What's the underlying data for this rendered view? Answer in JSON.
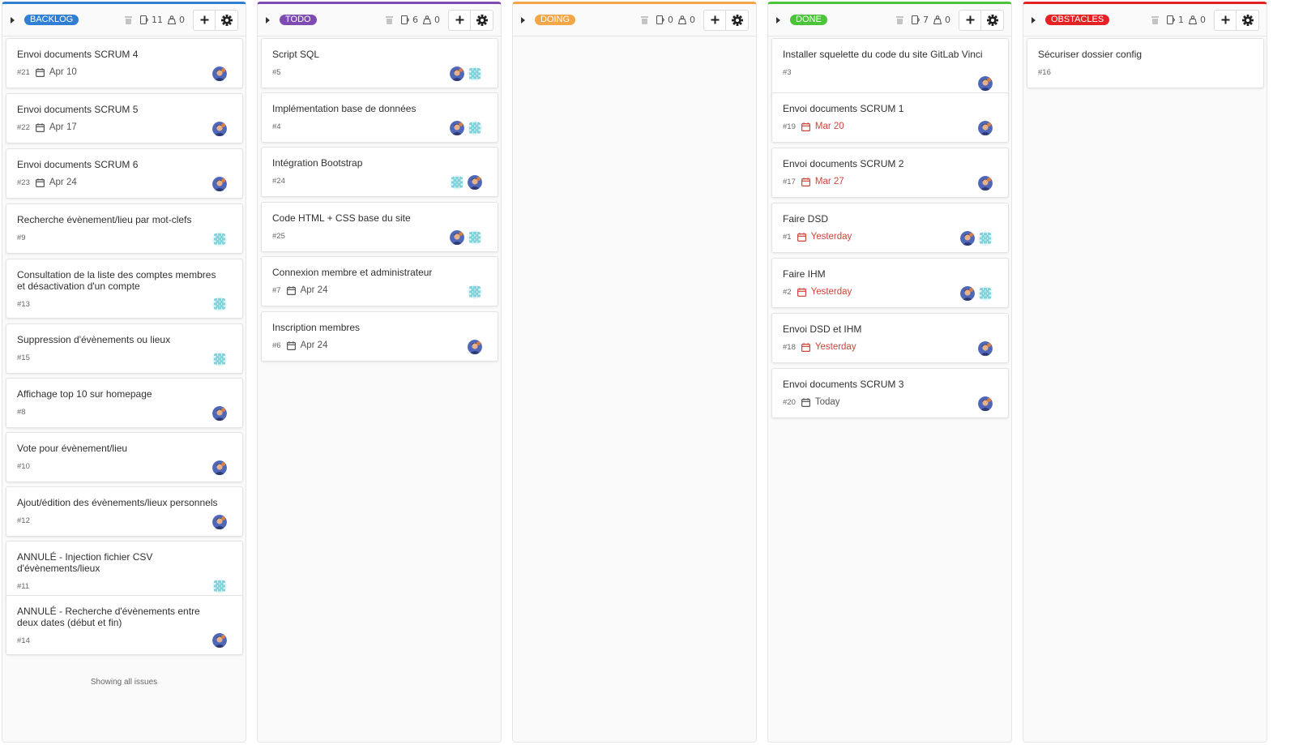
{
  "colors": {
    "backlog": "#2f7fd2",
    "todo": "#7e4bb3",
    "doing": "#f3a646",
    "done": "#4bc43a",
    "obstacles": "#e52124",
    "overdue": "#d0443a"
  },
  "columns": [
    {
      "label": "BACKLOG",
      "color_key": "backlog",
      "issues_count": "11",
      "weight_count": "0",
      "footer": "Showing all issues",
      "cards": [
        {
          "title": "Envoi documents SCRUM 4",
          "id": "#21",
          "date": "Apr 10",
          "date_state": "normal",
          "avatars": [
            "person"
          ]
        },
        {
          "title": "Envoi documents SCRUM 5",
          "id": "#22",
          "date": "Apr 17",
          "date_state": "normal",
          "avatars": [
            "person"
          ]
        },
        {
          "title": "Envoi documents SCRUM 6",
          "id": "#23",
          "date": "Apr 24",
          "date_state": "normal",
          "avatars": [
            "person"
          ]
        },
        {
          "title": "Recherche évènement/lieu par mot-clefs",
          "id": "#9",
          "date": "",
          "date_state": "none",
          "avatars": [
            "identicon"
          ]
        },
        {
          "title": "Consultation de la liste des comptes membres et désactivation d'un compte",
          "id": "#13",
          "date": "",
          "date_state": "none",
          "avatars": [
            "identicon"
          ]
        },
        {
          "title": "Suppression d'évènements ou lieux",
          "id": "#15",
          "date": "",
          "date_state": "none",
          "avatars": [
            "identicon"
          ]
        },
        {
          "title": "Affichage top 10 sur homepage",
          "id": "#8",
          "date": "",
          "date_state": "none",
          "avatars": [
            "person"
          ]
        },
        {
          "title": "Vote pour évènement/lieu",
          "id": "#10",
          "date": "",
          "date_state": "none",
          "avatars": [
            "person"
          ]
        },
        {
          "title": "Ajout/édition des évènements/lieux personnels",
          "id": "#12",
          "date": "",
          "date_state": "none",
          "avatars": [
            "person"
          ]
        },
        {
          "title": "ANNULÉ - Injection fichier CSV d'évènements/lieux",
          "id": "#11",
          "date": "",
          "date_state": "none",
          "avatars": [
            "identicon"
          ]
        },
        {
          "title": "ANNULÉ - Recherche d'évènements entre deux dates (début et fin)",
          "id": "#14",
          "date": "",
          "date_state": "none",
          "avatars": [
            "person"
          ]
        }
      ]
    },
    {
      "label": "TODO",
      "color_key": "todo",
      "issues_count": "6",
      "weight_count": "0",
      "footer": "",
      "cards": [
        {
          "title": "Script SQL",
          "id": "#5",
          "date": "",
          "date_state": "none",
          "avatars": [
            "person",
            "identicon"
          ]
        },
        {
          "title": "Implémentation base de données",
          "id": "#4",
          "date": "",
          "date_state": "none",
          "avatars": [
            "person",
            "identicon"
          ]
        },
        {
          "title": "Intégration Bootstrap",
          "id": "#24",
          "date": "",
          "date_state": "none",
          "avatars": [
            "identicon",
            "person"
          ]
        },
        {
          "title": "Code HTML + CSS base du site",
          "id": "#25",
          "date": "",
          "date_state": "none",
          "avatars": [
            "person",
            "identicon"
          ]
        },
        {
          "title": "Connexion membre et administrateur",
          "id": "#7",
          "date": "Apr 24",
          "date_state": "normal",
          "avatars": [
            "identicon"
          ]
        },
        {
          "title": "Inscription membres",
          "id": "#6",
          "date": "Apr 24",
          "date_state": "normal",
          "avatars": [
            "person"
          ]
        }
      ]
    },
    {
      "label": "DOING",
      "color_key": "doing",
      "issues_count": "0",
      "weight_count": "0",
      "footer": "",
      "cards": []
    },
    {
      "label": "DONE",
      "color_key": "done",
      "issues_count": "7",
      "weight_count": "0",
      "footer": "",
      "cards": [
        {
          "title": "Installer squelette du code du site GitLab Vinci",
          "id": "#3",
          "date": "",
          "date_state": "none",
          "avatars": [
            "person"
          ]
        },
        {
          "title": "Envoi documents SCRUM 1",
          "id": "#19",
          "date": "Mar 20",
          "date_state": "overdue",
          "avatars": [
            "person"
          ]
        },
        {
          "title": "Envoi documents SCRUM 2",
          "id": "#17",
          "date": "Mar 27",
          "date_state": "overdue",
          "avatars": [
            "person"
          ]
        },
        {
          "title": "Faire DSD",
          "id": "#1",
          "date": "Yesterday",
          "date_state": "overdue",
          "avatars": [
            "person",
            "identicon"
          ]
        },
        {
          "title": "Faire IHM",
          "id": "#2",
          "date": "Yesterday",
          "date_state": "overdue",
          "avatars": [
            "person",
            "identicon"
          ]
        },
        {
          "title": "Envoi DSD et IHM",
          "id": "#18",
          "date": "Yesterday",
          "date_state": "overdue",
          "avatars": [
            "person"
          ]
        },
        {
          "title": "Envoi documents SCRUM 3",
          "id": "#20",
          "date": "Today",
          "date_state": "today",
          "avatars": [
            "person"
          ]
        }
      ]
    },
    {
      "label": "OBSTACLES",
      "color_key": "obstacles",
      "issues_count": "1",
      "weight_count": "0",
      "footer": "",
      "cards": [
        {
          "title": "Sécuriser dossier config",
          "id": "#16",
          "date": "",
          "date_state": "none",
          "avatars": []
        }
      ]
    }
  ],
  "icons": {
    "collapse": "caret-right-icon",
    "delete": "trash-icon",
    "issues": "issues-icon",
    "weight": "weight-icon",
    "add": "plus-icon",
    "settings": "gear-icon",
    "due_date": "calendar-icon",
    "avatar_person": "avatar-person",
    "avatar_identicon": "avatar-identicon"
  }
}
